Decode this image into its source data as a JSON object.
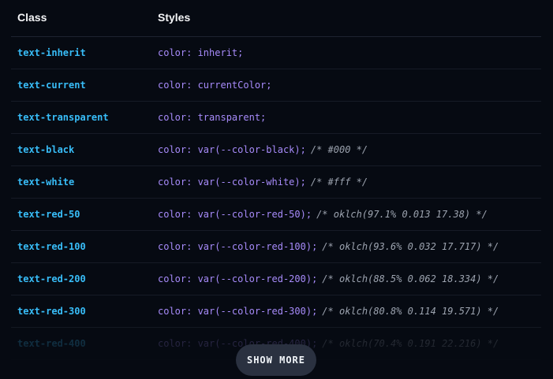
{
  "table": {
    "header": {
      "class": "Class",
      "styles": "Styles"
    },
    "rows": [
      {
        "cls": "text-inherit",
        "style": "color: inherit;",
        "comment": ""
      },
      {
        "cls": "text-current",
        "style": "color: currentColor;",
        "comment": ""
      },
      {
        "cls": "text-transparent",
        "style": "color: transparent;",
        "comment": ""
      },
      {
        "cls": "text-black",
        "style": "color: var(--color-black);",
        "comment": "/* #000 */"
      },
      {
        "cls": "text-white",
        "style": "color: var(--color-white);",
        "comment": "/* #fff */"
      },
      {
        "cls": "text-red-50",
        "style": "color: var(--color-red-50);",
        "comment": "/* oklch(97.1% 0.013 17.38) */"
      },
      {
        "cls": "text-red-100",
        "style": "color: var(--color-red-100);",
        "comment": "/* oklch(93.6% 0.032 17.717) */"
      },
      {
        "cls": "text-red-200",
        "style": "color: var(--color-red-200);",
        "comment": "/* oklch(88.5% 0.062 18.334) */"
      },
      {
        "cls": "text-red-300",
        "style": "color: var(--color-red-300);",
        "comment": "/* oklch(80.8% 0.114 19.571) */"
      },
      {
        "cls": "text-red-400",
        "style": "color: var(--color-red-400);",
        "comment": "/* oklch(70.4% 0.191 22.216) */"
      }
    ]
  },
  "show_more": {
    "label": "SHOW MORE"
  },
  "colors": {
    "background": "#060a12",
    "class_text": "#38bdf8",
    "style_text": "#a78bfa",
    "comment_text": "#9ca3af",
    "button_bg": "#2a3140"
  }
}
